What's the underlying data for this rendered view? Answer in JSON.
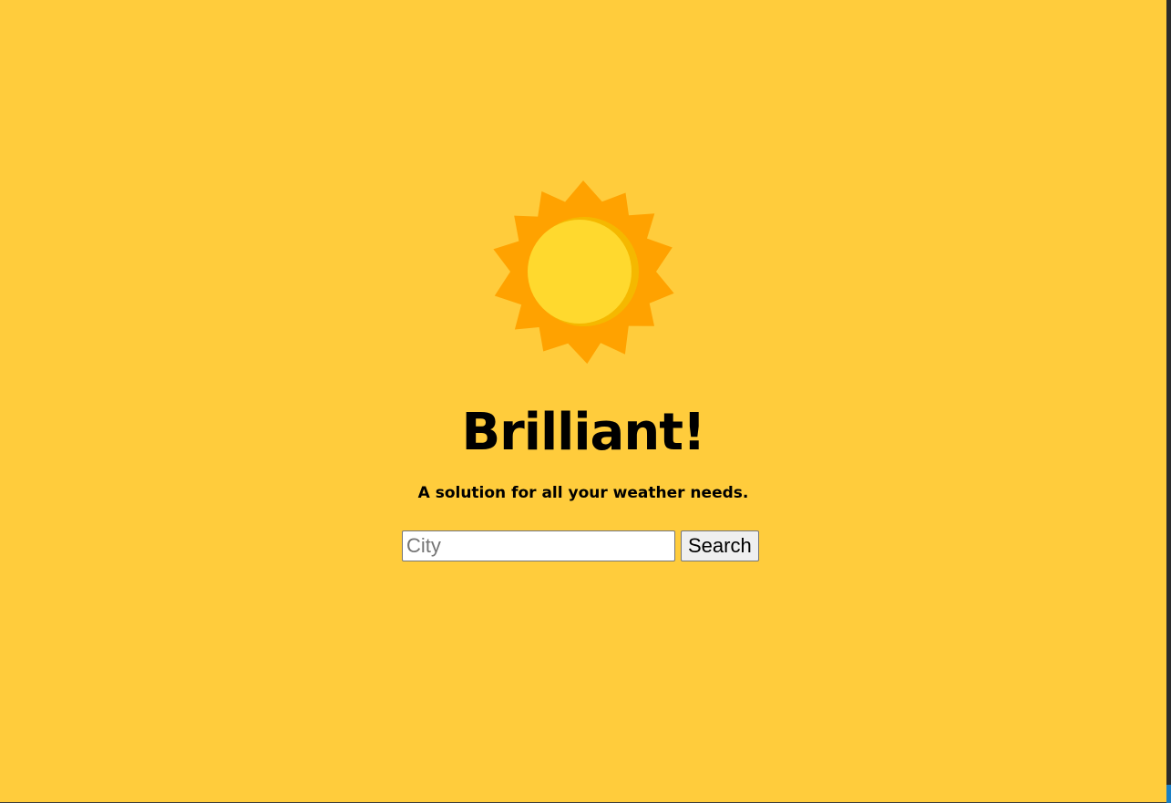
{
  "app": {
    "title": "Brilliant!",
    "tagline": "A solution for all your weather needs."
  },
  "hero": {
    "icon": "sun-icon",
    "colors": {
      "background": "#ffcc3c",
      "rays": "#ffa200",
      "disc": "#ffd92e",
      "disc_shadow": "#f5b800"
    }
  },
  "search": {
    "placeholder": "City",
    "value": "",
    "button_label": "Search"
  }
}
